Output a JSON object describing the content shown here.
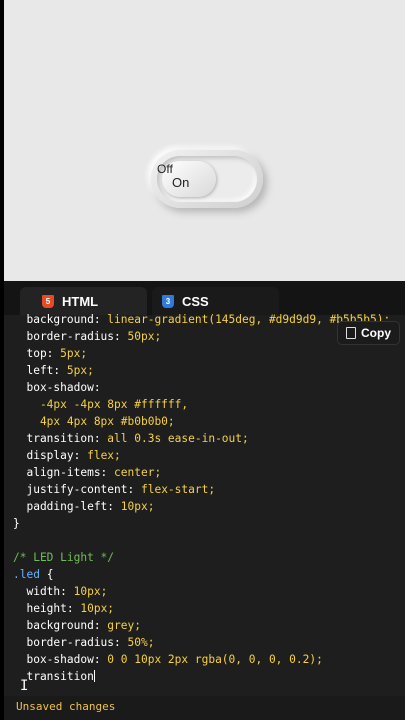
{
  "preview": {
    "toggle_off_label": "Off",
    "toggle_on_label": "On"
  },
  "editor": {
    "tabs": [
      {
        "label": "HTML",
        "icon": "html5-icon"
      },
      {
        "label": "CSS",
        "icon": "css3-icon"
      }
    ],
    "copy_label": "Copy",
    "code_lines": [
      "  background: linear-gradient(145deg, #d9d9d9, #b5b5b5);",
      "  border-radius: 50px;",
      "  top: 5px;",
      "  left: 5px;",
      "  box-shadow:",
      "    -4px -4px 8px #ffffff,",
      "    4px 4px 8px #b0b0b0;",
      "  transition: all 0.3s ease-in-out;",
      "  display: flex;",
      "  align-items: center;",
      "  justify-content: flex-start;",
      "  padding-left: 10px;",
      "}",
      "",
      "/* LED Light */",
      ".led {",
      "  width: 10px;",
      "  height: 10px;",
      "  background: grey;",
      "  border-radius: 50%;",
      "  box-shadow: 0 0 10px 2px rgba(0, 0, 0, 0.2);",
      "  transition"
    ],
    "status": "Unsaved changes"
  },
  "colors": {
    "property": "#ffffff",
    "value": "#f5d142",
    "comment": "#6fbf57",
    "selector": "#66b3ff",
    "status": "#f0c24a"
  }
}
